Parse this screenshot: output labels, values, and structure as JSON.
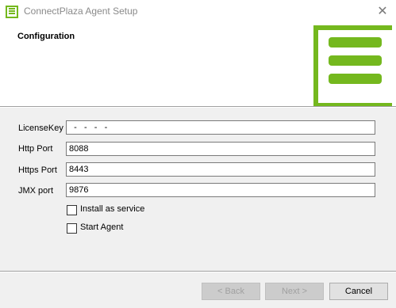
{
  "window": {
    "title": "ConnectPlaza Agent Setup",
    "close_glyph": "✕",
    "app_icon": "list-icon"
  },
  "header": {
    "title": "Configuration",
    "logo_icon": "connectplaza-logo-icon",
    "accent_color": "#74b81e"
  },
  "form": {
    "license_key": {
      "label": "LicenseKey",
      "value": "  -   -   -   -"
    },
    "http_port": {
      "label": "Http Port",
      "value": "8088"
    },
    "https_port": {
      "label": "Https Port",
      "value": "8443"
    },
    "jmx_port": {
      "label": "JMX port",
      "value": "9876"
    },
    "install_service": {
      "label": "Install as service",
      "checked": false
    },
    "start_agent": {
      "label": "Start Agent",
      "checked": false
    }
  },
  "buttons": {
    "back": "< Back",
    "next": "Next >",
    "cancel": "Cancel"
  }
}
